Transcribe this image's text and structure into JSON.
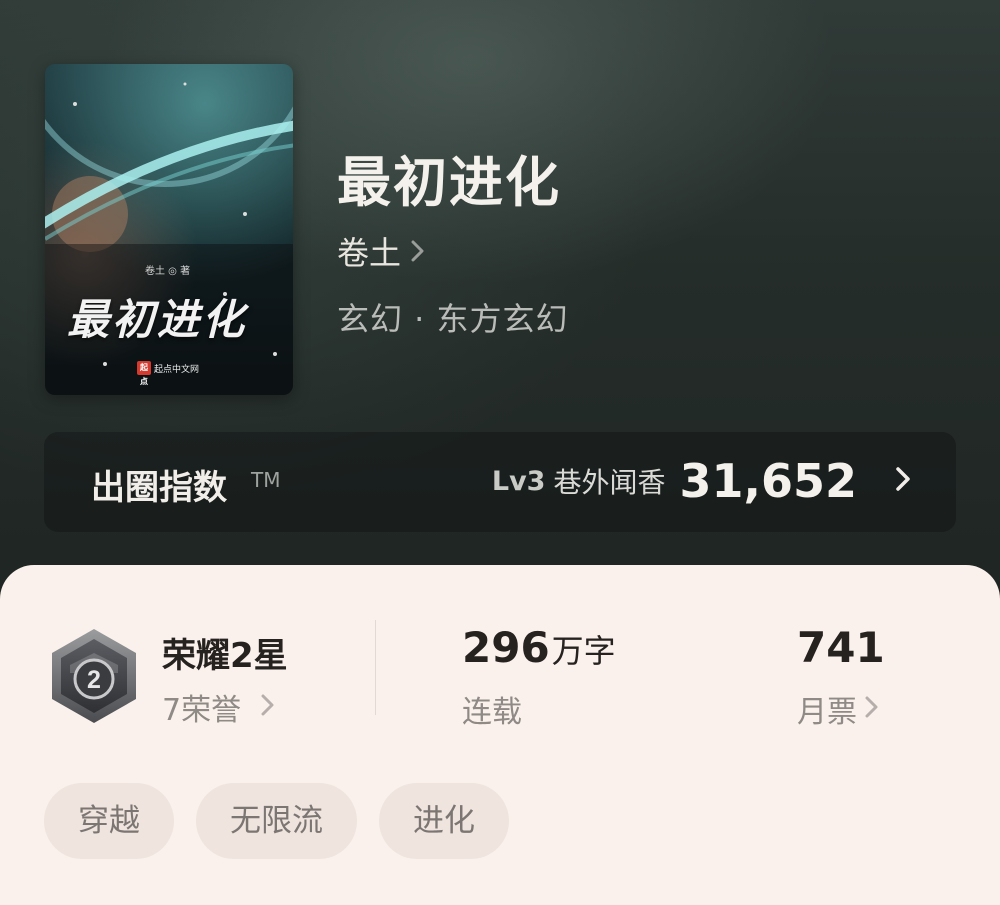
{
  "book": {
    "title": "最初进化",
    "author": "卷土",
    "genre": "玄幻 · 东方玄幻"
  },
  "cover": {
    "title_art": "最初进化",
    "author_line": "卷土 ◎ 著",
    "publisher_logo": "起点",
    "publisher": "起点中文网"
  },
  "index": {
    "label": "出圈指数",
    "tm": "TM",
    "level": "Lv3",
    "level_name": "巷外闻香",
    "score": "31,652"
  },
  "stats": {
    "honor": {
      "title": "荣耀2星",
      "sub": "7荣誉",
      "badge_number": "2"
    },
    "words": {
      "value": "296",
      "unit": "万字",
      "label": "连载"
    },
    "votes": {
      "value": "741",
      "label": "月票"
    }
  },
  "tags": [
    "穿越",
    "无限流",
    "进化"
  ],
  "colors": {
    "hero_bg": "#252d2a",
    "panel_bg": "#faf1ec",
    "tag_bg": "#efe4de",
    "text_dark": "#262220",
    "text_muted": "#8f8a86"
  },
  "icons": {
    "author_link": "chevron-right-icon",
    "index_link": "chevron-right-icon",
    "honor_link": "chevron-right-icon",
    "votes_link": "chevron-right-icon",
    "honor_badge": "hexagon-badge-icon"
  }
}
